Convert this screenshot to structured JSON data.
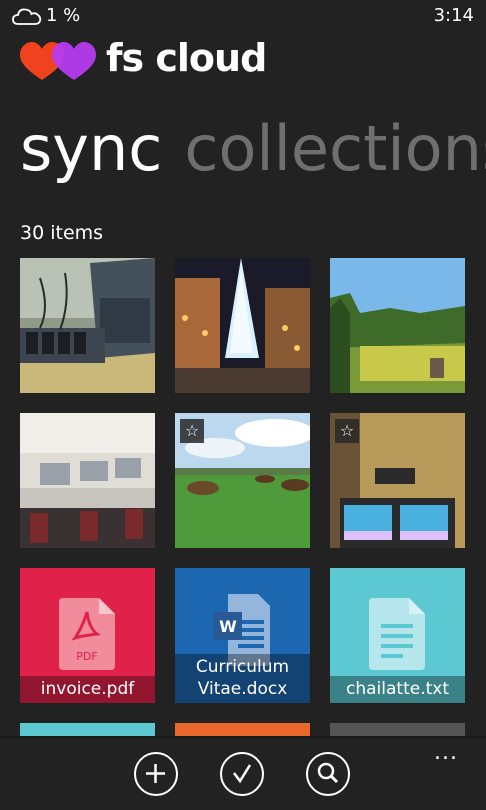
{
  "status_bar": {
    "battery": "1 %",
    "time": "3:14",
    "cloud_icon": "cloud-icon"
  },
  "app": {
    "name": "fs cloud",
    "logo_colors": [
      "#f0421f",
      "#b63cf0"
    ]
  },
  "pivot": {
    "active": "sync",
    "next": "collections"
  },
  "list": {
    "count_label": "30 items"
  },
  "tiles": [
    {
      "kind": "photo",
      "subject": "charging-devices",
      "starred": false
    },
    {
      "kind": "photo",
      "subject": "christmas-tree-night",
      "starred": false
    },
    {
      "kind": "photo",
      "subject": "green-landscape",
      "starred": false
    },
    {
      "kind": "photo",
      "subject": "computer-lab",
      "starred": false
    },
    {
      "kind": "photo",
      "subject": "horses-field",
      "starred": true
    },
    {
      "kind": "photo",
      "subject": "tv-studio",
      "starred": true
    },
    {
      "kind": "document",
      "file": "invoice.pdf",
      "type": "pdf",
      "color": "#e0224a",
      "icon_label": "PDF"
    },
    {
      "kind": "document",
      "file": "Curriculum Vitae.docx",
      "type": "docx",
      "color": "#1d67b0",
      "icon_label": "W"
    },
    {
      "kind": "document",
      "file": "chailatte.txt",
      "type": "txt",
      "color": "#5bc8d2"
    }
  ],
  "app_bar": {
    "buttons": [
      {
        "name": "add-button",
        "icon": "plus-icon"
      },
      {
        "name": "select-button",
        "icon": "check-icon"
      },
      {
        "name": "search-button",
        "icon": "search-icon"
      }
    ],
    "more": "..."
  }
}
